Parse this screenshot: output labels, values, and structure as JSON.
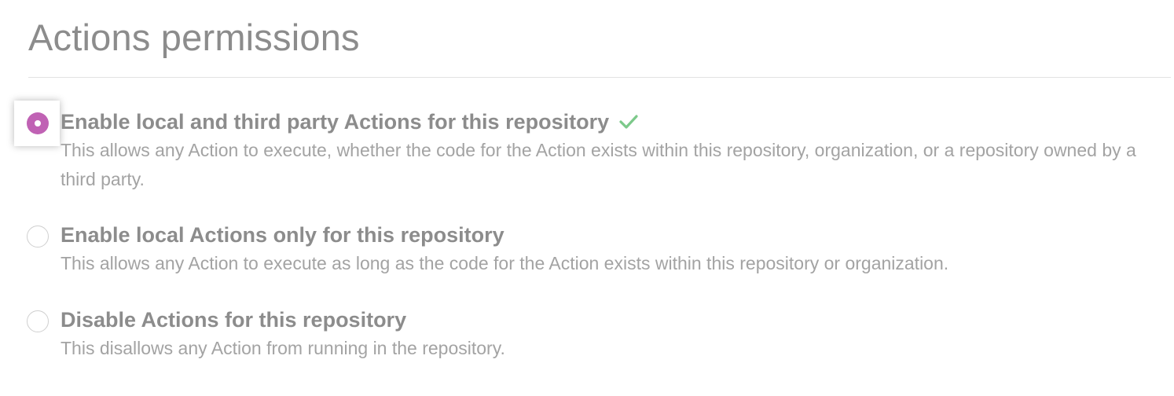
{
  "page": {
    "title": "Actions permissions"
  },
  "options": [
    {
      "label": "Enable local and third party Actions for this repository",
      "description": "This allows any Action to execute, whether the code for the Action exists within this repository, organization, or a repository owned by a third party.",
      "selected": true,
      "saved_indicator": "check-icon"
    },
    {
      "label": "Enable local Actions only for this repository",
      "description": "This allows any Action to execute as long as the code for the Action exists within this repository or organization.",
      "selected": false
    },
    {
      "label": "Disable Actions for this repository",
      "description": "This disallows any Action from running in the repository.",
      "selected": false
    }
  ],
  "colors": {
    "radio_selected": "#c062b4",
    "check": "#7cc98a",
    "title_text": "#8c8c8c",
    "description_text": "#a3a3a3"
  }
}
